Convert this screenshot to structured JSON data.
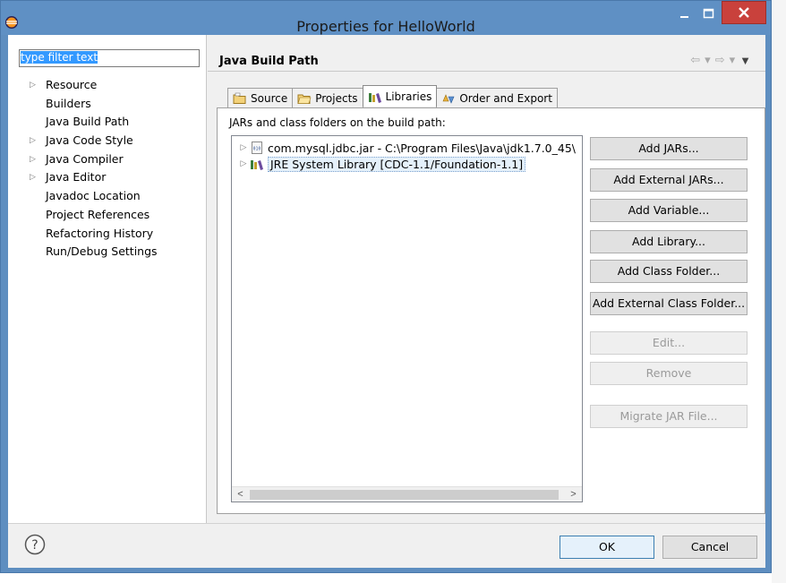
{
  "window": {
    "title": "Properties for HelloWorld"
  },
  "filter": {
    "placeholder": "type filter text"
  },
  "nav": {
    "items": [
      {
        "label": "Resource",
        "expandable": true
      },
      {
        "label": "Builders",
        "expandable": false
      },
      {
        "label": "Java Build Path",
        "expandable": false,
        "selected": true
      },
      {
        "label": "Java Code Style",
        "expandable": true
      },
      {
        "label": "Java Compiler",
        "expandable": true
      },
      {
        "label": "Java Editor",
        "expandable": true
      },
      {
        "label": "Javadoc Location",
        "expandable": false
      },
      {
        "label": "Project References",
        "expandable": false
      },
      {
        "label": "Refactoring History",
        "expandable": false
      },
      {
        "label": "Run/Debug Settings",
        "expandable": false
      }
    ]
  },
  "page": {
    "title": "Java Build Path",
    "tabs": [
      {
        "label": "Source",
        "icon": "source-folder-icon"
      },
      {
        "label": "Projects",
        "icon": "projects-folder-icon"
      },
      {
        "label": "Libraries",
        "icon": "libraries-icon",
        "active": true
      },
      {
        "label": "Order and Export",
        "icon": "order-export-icon"
      }
    ],
    "caption": "JARs and class folders on the build path:",
    "libraries": [
      {
        "label": "com.mysql.jdbc.jar - C:\\Program Files\\Java\\jdk1.7.0_45\\",
        "icon": "jar-icon"
      },
      {
        "label": "JRE System Library [CDC-1.1/Foundation-1.1]",
        "icon": "jre-library-icon",
        "selected": true
      }
    ],
    "buttons": [
      {
        "label": "Add JARs...",
        "enabled": true
      },
      {
        "label": "Add External JARs...",
        "enabled": true
      },
      {
        "label": "Add Variable...",
        "enabled": true
      },
      {
        "label": "Add Library...",
        "enabled": true
      },
      {
        "label": "Add Class Folder...",
        "enabled": true
      },
      {
        "label": "Add External Class Folder...",
        "enabled": true
      },
      {
        "label": "Edit...",
        "enabled": false
      },
      {
        "label": "Remove",
        "enabled": false
      },
      {
        "label": "Migrate JAR File...",
        "enabled": false
      }
    ]
  },
  "footer": {
    "ok_label": "OK",
    "cancel_label": "Cancel"
  },
  "colors": {
    "title_bar": "#5f90c4",
    "close_button": "#c9413c",
    "selection": "#3399ff"
  }
}
